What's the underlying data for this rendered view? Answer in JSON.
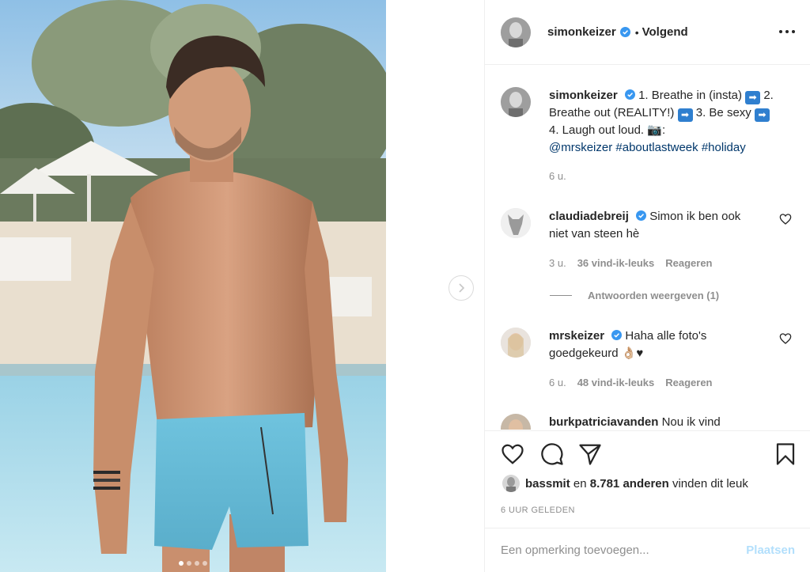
{
  "post": {
    "author": "simonkeizer",
    "follow_state": "Volgend",
    "separator": "•",
    "caption": {
      "part1": "1. Breathe in (insta)",
      "part2": "2. Breathe out (REALITY!)",
      "part3": "3. Be sexy",
      "part4": "4. Laugh out loud.",
      "camera_emoji": "📷:",
      "mention": "@mrskeizer",
      "tag1": "#aboutlastweek",
      "tag2": "#holiday",
      "age": "6 u."
    },
    "carousel": {
      "count": 4,
      "active_index": 0
    }
  },
  "comments": [
    {
      "user": "claudiadebreij",
      "text": "Simon ik ben ook niet van steen hè",
      "age": "3 u.",
      "likes": "36 vind-ik-leuks",
      "reply": "Reageren",
      "view_replies": "Antwoorden weergeven (1)"
    },
    {
      "user": "mrskeizer",
      "text": "Haha alle foto's goedgekeurd",
      "emoji": "👌🏼♥",
      "age": "6 u.",
      "likes": "48 vind-ik-leuks",
      "reply": "Reageren"
    },
    {
      "user": "burkpatriciavanden",
      "text": "Nou ik vind"
    }
  ],
  "engagement": {
    "liked_by_user": "bassmit",
    "liked_by_mid": " en ",
    "liked_by_count": "8.781 anderen",
    "liked_by_suffix": " vinden dit leuk",
    "time_ago": "6 UUR GELEDEN"
  },
  "comment_form": {
    "placeholder": "Een opmerking toevoegen...",
    "post_label": "Plaatsen"
  },
  "icons": {
    "verified": "verified-badge-icon",
    "like": "heart-icon",
    "comment": "comment-icon",
    "share": "share-icon",
    "save": "bookmark-icon",
    "more": "more-options-icon",
    "next": "chevron-right-icon",
    "arrow_emoji": "right-arrow-emoji-icon"
  },
  "colors": {
    "verified_blue": "#3897f0",
    "link": "#00376b",
    "muted": "#8e8e8e",
    "post_disabled": "#b2dffc",
    "arrow_emoji_bg": "#2f7fcf"
  }
}
